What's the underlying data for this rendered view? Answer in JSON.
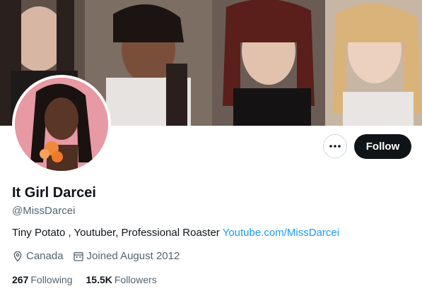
{
  "profile": {
    "display_name": "It Girl Darcei",
    "handle": "@MissDarcei",
    "bio_text": "Tiny Potato , Youtuber, Professional Roaster ",
    "bio_link": "Youtube.com/MissDarcei",
    "location": "Canada",
    "joined": "Joined August 2012"
  },
  "stats": {
    "following_count": "267",
    "following_label": "Following",
    "followers_count": "15.5K",
    "followers_label": "Followers"
  },
  "actions": {
    "follow_label": "Follow",
    "more_icon": "more-dots-icon"
  },
  "colors": {
    "link": "#1d9bf0",
    "follow_bg": "#0f1419",
    "secondary_text": "#536471"
  }
}
